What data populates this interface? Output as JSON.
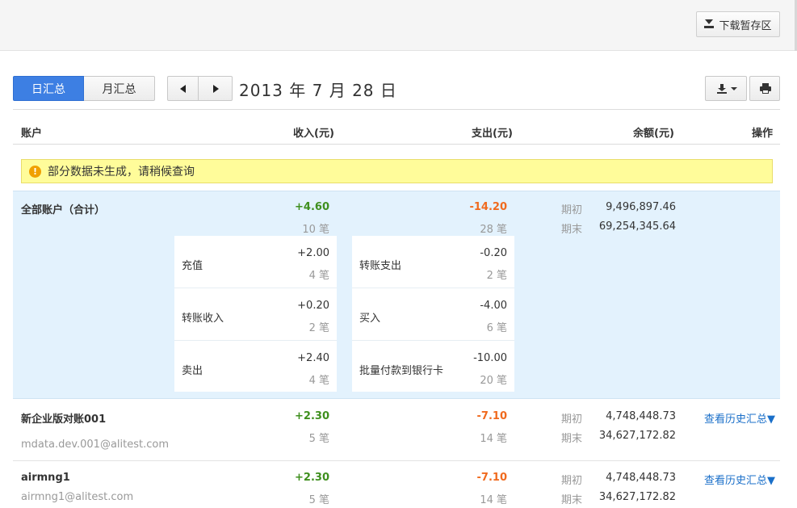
{
  "toolbar": {
    "download_area_label": "下载暂存区"
  },
  "tabs": [
    {
      "label": "日汇总"
    },
    {
      "label": "月汇总"
    }
  ],
  "date": {
    "year": "2013",
    "year_unit": "年",
    "month": "7",
    "month_unit": "月",
    "day": "28",
    "day_unit": "日"
  },
  "table": {
    "headers": {
      "account": "账户",
      "income": "收入(元)",
      "expense": "支出(元)",
      "balance": "余额(元)",
      "action": "操作"
    }
  },
  "notice": {
    "text": "部分数据未生成，请稍候查询"
  },
  "labels": {
    "opening": "期初",
    "closing": "期末"
  },
  "total": {
    "name": "全部账户（合计）",
    "income": "+4.60",
    "income_count": "10 笔",
    "expense": "-14.20",
    "expense_count": "28 笔",
    "opening_balance": "9,496,897.46",
    "closing_balance": "69,254,345.64",
    "income_breakdown": [
      {
        "label": "充值",
        "amount": "+2.00",
        "count": "4 笔"
      },
      {
        "label": "转账收入",
        "amount": "+0.20",
        "count": "2 笔"
      },
      {
        "label": "卖出",
        "amount": "+2.40",
        "count": "4 笔"
      }
    ],
    "expense_breakdown": [
      {
        "label": "转账支出",
        "amount": "-0.20",
        "count": "2 笔"
      },
      {
        "label": "买入",
        "amount": "-4.00",
        "count": "6 笔"
      },
      {
        "label": "批量付款到银行卡",
        "amount": "-10.00",
        "count": "20 笔"
      }
    ]
  },
  "accounts": [
    {
      "name": "新企业版对账001",
      "email": "mdata.dev.001@alitest.com",
      "income": "+2.30",
      "income_count": "5 笔",
      "expense": "-7.10",
      "expense_count": "14 笔",
      "opening_balance": "4,748,448.73",
      "closing_balance": "34,627,172.82",
      "action": "查看历史汇总▼"
    },
    {
      "name": "airmng1",
      "email": "airmng1@alitest.com",
      "income": "+2.30",
      "income_count": "5 笔",
      "expense": "-7.10",
      "expense_count": "14 笔",
      "opening_balance": "4,748,448.73",
      "closing_balance": "34,627,172.82",
      "action": "查看历史汇总▼"
    }
  ],
  "icons": {
    "download": "download-icon",
    "print": "print-icon",
    "prev": "prev-arrow-icon",
    "next": "next-arrow-icon",
    "warning": "warning-icon"
  },
  "colors": {
    "accent": "#3d7fe3",
    "income": "#3f8f1e",
    "expense": "#f06a1e",
    "link": "#1a6fc9",
    "highlight_bg": "#e3f2fd",
    "notice_bg": "#fffc9a"
  }
}
